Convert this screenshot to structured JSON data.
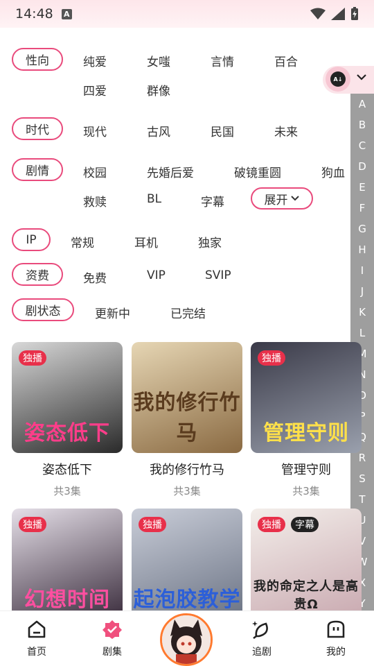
{
  "status_bar": {
    "time": "14:48",
    "a_badge": "A"
  },
  "filters": {
    "orientation": {
      "label": "性向",
      "options": [
        "纯爱",
        "女嗤",
        "言情",
        "百合",
        "四爱",
        "群像"
      ]
    },
    "era": {
      "label": "时代",
      "options": [
        "现代",
        "古风",
        "民国",
        "未来"
      ]
    },
    "plot": {
      "label": "剧情",
      "options": [
        "校园",
        "先婚后爱",
        "破镜重圆",
        "狗血",
        "救赎",
        "BL",
        "字幕"
      ],
      "expand_label": "展开"
    },
    "ip": {
      "label": "IP",
      "options": [
        "常规",
        "耳机",
        "独家"
      ]
    },
    "fee": {
      "label": "资费",
      "options": [
        "免费",
        "VIP",
        "SVIP"
      ]
    },
    "status": {
      "label": "剧状态",
      "options": [
        "更新中",
        "已完结"
      ]
    }
  },
  "sort": {
    "icon": "sort-az-icon",
    "accent": "#e94a7c"
  },
  "alphabet": [
    "A",
    "B",
    "C",
    "D",
    "E",
    "F",
    "G",
    "H",
    "I",
    "J",
    "K",
    "L",
    "M",
    "N",
    "O",
    "P",
    "Q",
    "R",
    "S",
    "T",
    "U",
    "V",
    "W",
    "X",
    "Y"
  ],
  "dramas": [
    {
      "name": "姿态低下",
      "episodes": "共3集",
      "badges": [
        "独播"
      ],
      "art_title": "姿态低下",
      "colors": [
        "#d8d8d8",
        "#2a2a2a"
      ],
      "title_color": "#ff3d8a"
    },
    {
      "name": "我的修行竹马",
      "episodes": "共3集",
      "badges": [],
      "art_title": "我的修行竹马",
      "colors": [
        "#e6d6b4",
        "#8a6a42"
      ],
      "title_color": "#5a3b1e"
    },
    {
      "name": "管理守则",
      "episodes": "共3集",
      "badges": [
        "独播"
      ],
      "art_title": "管理守则",
      "colors": [
        "#3a3a48",
        "#9aa0ad"
      ],
      "title_color": "#ffe04a"
    },
    {
      "name": "",
      "episodes": "",
      "badges": [
        "独播"
      ],
      "art_title": "幻想时间",
      "colors": [
        "#e5dfe8",
        "#3a2c3c"
      ],
      "title_color": "#ff4fa0"
    },
    {
      "name": "",
      "episodes": "",
      "badges": [
        "独播"
      ],
      "art_title": "起泡胶教学",
      "colors": [
        "#c9cdd8",
        "#6b7384"
      ],
      "title_color": "#2c5fd8"
    },
    {
      "name": "",
      "episodes": "",
      "badges": [
        "独播",
        "字幕"
      ],
      "art_title": "我的命定之人是高贵Ω",
      "colors": [
        "#f3eeea",
        "#c9a9b0"
      ],
      "title_color": "#222222"
    }
  ],
  "bottom_nav": {
    "home": "首页",
    "drama": "剧集",
    "follow": "追剧",
    "mine": "我的"
  }
}
